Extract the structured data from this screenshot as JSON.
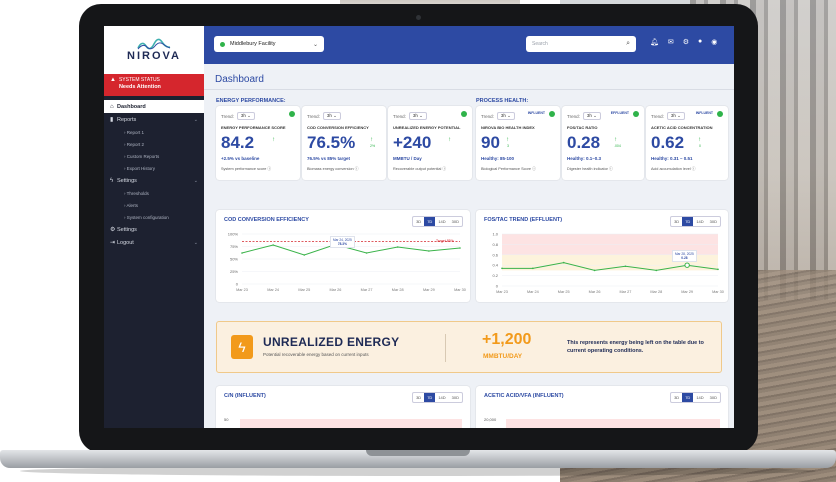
{
  "facility_selector": {
    "value": "Middlebury Facility"
  },
  "search": {
    "placeholder": "Search"
  },
  "brand": {
    "logo_text": "NIROVA"
  },
  "status": {
    "label": "SYSTEM STATUS",
    "value": "Needs Attention"
  },
  "sidebar": {
    "items": [
      {
        "label": "Dashboard",
        "icon": "home-icon",
        "active": true
      },
      {
        "label": "Reports",
        "icon": "document-icon",
        "expandable": true
      },
      {
        "label": "› Report 1",
        "sub": true
      },
      {
        "label": "› Report 2",
        "sub": true
      },
      {
        "label": "› Custom Reports",
        "sub": true
      },
      {
        "label": "› Export History",
        "sub": true
      },
      {
        "label": "Settings",
        "icon": "bolt-icon",
        "expandable": true
      },
      {
        "label": "› Thresholds",
        "sub": true
      },
      {
        "label": "› Alerts",
        "sub": true
      },
      {
        "label": "› System configuration",
        "sub": true
      },
      {
        "label": "Settings",
        "icon": "gear-icon"
      },
      {
        "label": "Logout",
        "icon": "logout-icon",
        "expandable": true
      }
    ]
  },
  "page": {
    "title": "Dashboard"
  },
  "sections": {
    "energy": "ENERGY PERFORMANCE:",
    "process": "PROCESS HEALTH:"
  },
  "trend": {
    "label": "Trend:",
    "value": "3h ⌄"
  },
  "metrics": [
    {
      "name": "ENERGY PERFORMANCE SCORE",
      "value": "84.2",
      "delta": "↑",
      "sub": "+2.5% vs baseline",
      "foot": "System performance score ⓘ"
    },
    {
      "name": "COD CONVERSION EFFICIENCY",
      "value": "76.5%",
      "delta": "↑",
      "delta_note": "2%",
      "sub": "76.5% vs 85% target",
      "foot": "Biomass energy conversion ⓘ"
    },
    {
      "name": "UNREALIZED ENERGY POTENTIAL",
      "value": "+240",
      "delta": "↑",
      "sub": "MMBTU / Day",
      "foot": "Recoverable output potential ⓘ"
    },
    {
      "name": "NIROVA BIO HEALTH INDEX",
      "value": "90",
      "delta": "↑",
      "delta_note": "3",
      "badge": "INFLUENT",
      "sub": "Healthy: 85-100",
      "foot": "Biological Performance Score ⓘ"
    },
    {
      "name": "FOS/TAC RATIO",
      "value": "0.28",
      "delta": "↑",
      "delta_note": ".004",
      "badge": "EFFLUENT",
      "sub": "Healthy: 0.1–0.3",
      "foot": "Digester health indicator ⓘ"
    },
    {
      "name": "ACETIC ACID CONCENTRATION",
      "value": "0.62",
      "delta": "↑",
      "delta_note": "0",
      "badge": "INFLUENT",
      "sub": "Healthy: 0.31 – 0.51",
      "foot": "Acid accumulation level ⓘ"
    }
  ],
  "periods": [
    "3D",
    "7D",
    "14D",
    "30D"
  ],
  "charts": {
    "cod": {
      "title": "COD CONVERSION EFFICIENCY",
      "target_label": "Target 85%",
      "callout_date": "Mar 24, 2025",
      "callout_value": "78.3%"
    },
    "fostac": {
      "title": "FOS/TAC TREND (EFFLUENT)",
      "callout_date": "Mar 28, 2025",
      "callout_value": "0.28"
    },
    "cn": {
      "title": "C/N (INFLUENT)",
      "y_top": "50"
    },
    "acetic": {
      "title": "ACETIC ACID/VFA (INFLUENT)",
      "y_top": "20,000"
    }
  },
  "chart_data": [
    {
      "type": "line",
      "title": "COD CONVERSION EFFICIENCY",
      "x": [
        "Mar 23",
        "Mar 24",
        "Mar 25",
        "Mar 26",
        "Mar 27",
        "Mar 28",
        "Mar 29",
        "Mar 30"
      ],
      "y_ticks": [
        "100%",
        "75%",
        "50%",
        "25%",
        "0"
      ],
      "series": [
        {
          "values": [
            62,
            78,
            58,
            79,
            62,
            74,
            66,
            72
          ]
        }
      ],
      "target": 85,
      "ylim": [
        0,
        100
      ]
    },
    {
      "type": "line",
      "title": "FOS/TAC TREND (EFFLUENT)",
      "x": [
        "Mar 23",
        "Mar 24",
        "Mar 25",
        "Mar 26",
        "Mar 27",
        "Mar 28",
        "Mar 29",
        "Mar 30"
      ],
      "y_ticks": [
        "1.0",
        "0.8",
        "0.6",
        "0.4",
        "0.2",
        "0"
      ],
      "series": [
        {
          "values": [
            0.34,
            0.34,
            0.45,
            0.3,
            0.38,
            0.3,
            0.4,
            0.32
          ]
        }
      ],
      "ylim": [
        0,
        1.0
      ]
    }
  ],
  "unrealized": {
    "title": "UNREALIZED ENERGY",
    "subtitle": "Potential recoverable energy based on current inputs",
    "value": "+1,200",
    "unit": "MMBTU/DAY",
    "note": "This represents energy being left on the table due to current operating conditions."
  },
  "colors": {
    "accent": "#2d4aa3",
    "alert": "#d5262d",
    "good": "#2fb34a",
    "energy": "#f29a1b"
  }
}
